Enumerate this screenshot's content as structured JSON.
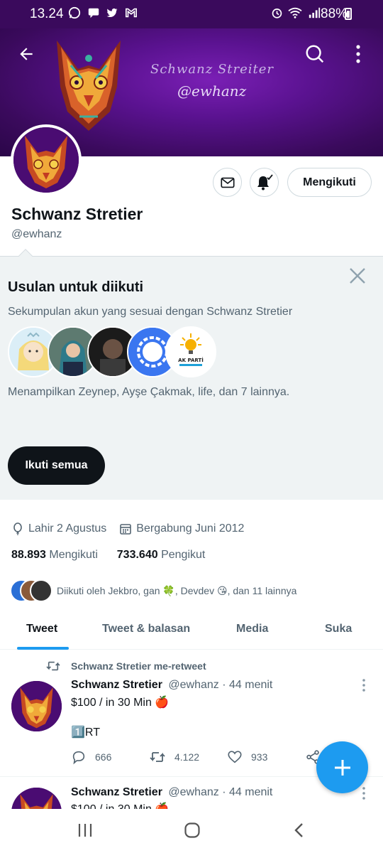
{
  "status_bar": {
    "time": "13.24",
    "battery": "88%",
    "left_icons": [
      "whatsapp-icon",
      "message-icon",
      "twitter-icon",
      "gmail-icon"
    ],
    "right_icons": [
      "alarm-icon",
      "wifi-icon",
      "signal-icon",
      "battery-icon"
    ]
  },
  "banner": {
    "script_text": "Schwanz Streiter",
    "handle_text": "@ewhanz"
  },
  "profile": {
    "name": "Schwanz Stretier",
    "handle": "@ewhanz",
    "following_button": "Mengikuti",
    "birthday": "Lahir 2 Agustus",
    "joined": "Bergabung Juni 2012",
    "following_count": "88.893",
    "following_label": "Mengikuti",
    "followers_count": "733.640",
    "followers_label": "Pengikut",
    "followed_by": "Diikuti oleh Jekbro, gan 🍀, Devdev 😘, dan 11 lainnya"
  },
  "suggestions": {
    "title": "Usulan untuk diikuti",
    "subtitle": "Sekumpulan akun yang sesuai dengan Schwanz Stretier",
    "showing": "Menampilkan Zeynep, Ayşe Çakmak, life, dan 7 lainnya.",
    "follow_all": "Ikuti semua",
    "akparti_text": "AK PARTİ"
  },
  "tabs": [
    {
      "label": "Tweet",
      "active": true
    },
    {
      "label": "Tweet & balasan",
      "active": false
    },
    {
      "label": "Media",
      "active": false
    },
    {
      "label": "Suka",
      "active": false
    }
  ],
  "tweets": [
    {
      "retweet_label": "Schwanz Stretier me-retweet",
      "name": "Schwanz Stretier",
      "handle_time": "@ewhanz · 44 menit",
      "line1": "$100 / in 30 Min 🍎",
      "line2": "1️⃣RT",
      "replies": "666",
      "retweets": "4.122",
      "likes": "933"
    },
    {
      "name": "Schwanz Stretier",
      "handle_time": "@ewhanz · 44 menit",
      "line1": "$100 / in 30 Min 🍎"
    }
  ],
  "colors": {
    "accent": "#1d9bf0",
    "banner": "#5a1290",
    "text": "#0f1419",
    "muted": "#536471"
  }
}
